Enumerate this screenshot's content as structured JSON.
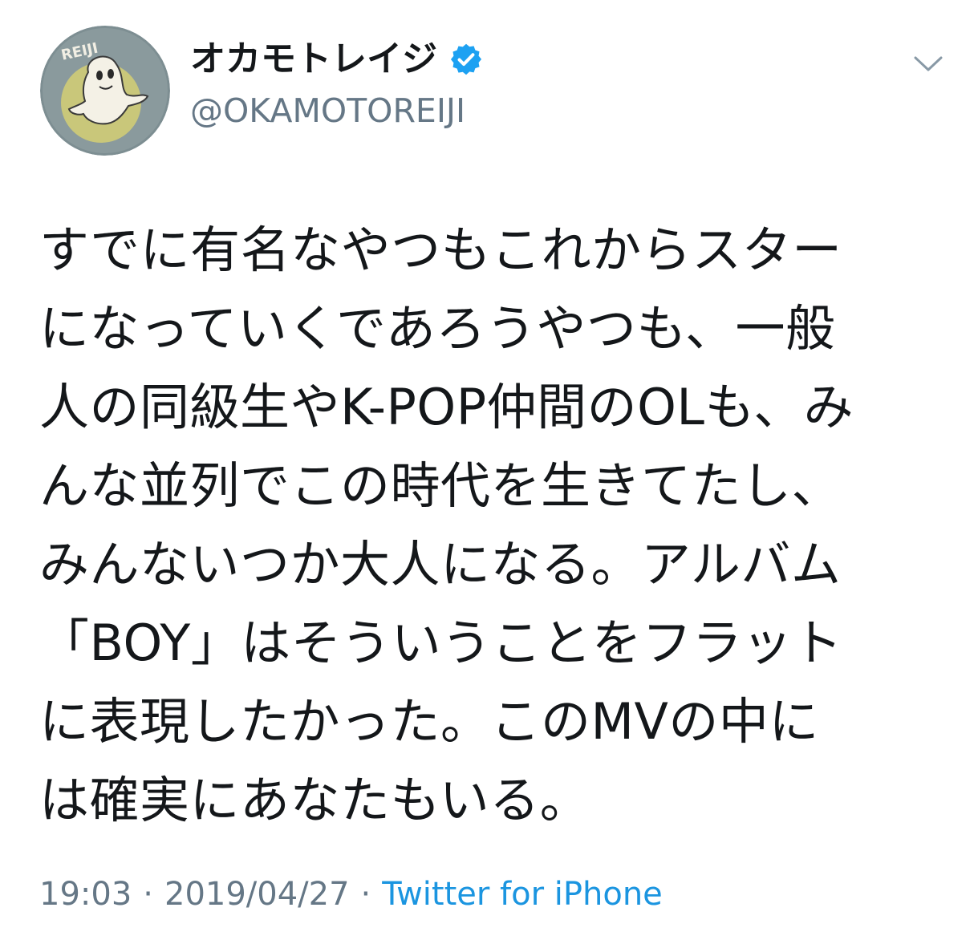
{
  "tweet": {
    "display_name": "オカモトレイジ",
    "handle": "@OKAMOTOREIJI",
    "avatar_text": "REIJI",
    "text_lines": [
      "すでに有名なやつもこれからスター",
      "になっていくであろうやつも、一般",
      "人の同級生やK-POP仲間のOLも、み",
      "んな並列でこの時代を生きてたし、",
      "みんないつか大人になる。アルバム",
      "「BOY」はそういうことをフラット",
      "に表現したかった。このMVの中に",
      "は確実にあなたもいる。"
    ],
    "time": "19:03",
    "separator": "·",
    "date": "2019/04/27",
    "source": "Twitter for iPhone"
  },
  "icons": {
    "verified": "verified-badge-icon",
    "caret": "chevron-down-icon"
  },
  "colors": {
    "text": "#14171a",
    "secondary": "#657786",
    "link": "#1b95e0",
    "verified": "#1da1f2",
    "avatar_bg": "#7d8e92",
    "avatar_moon": "#c9c77a"
  }
}
